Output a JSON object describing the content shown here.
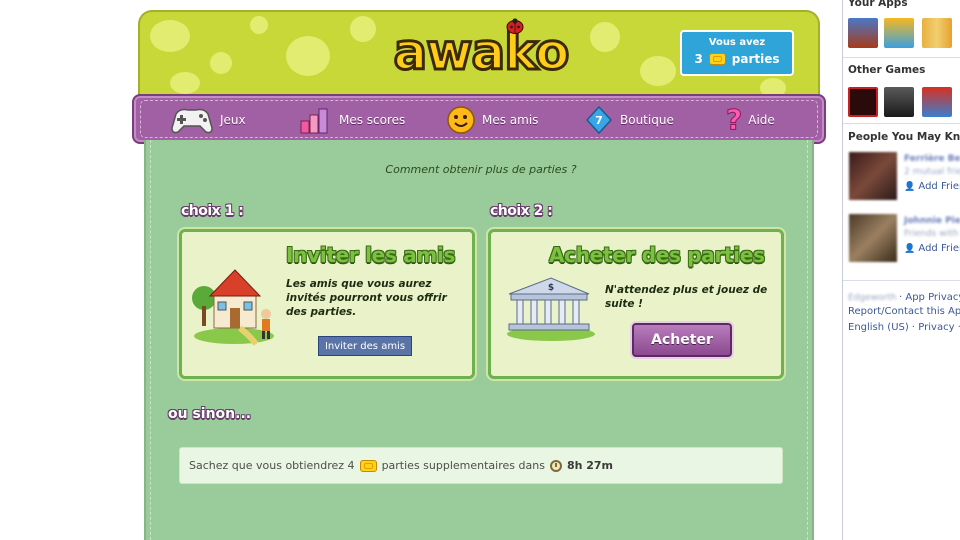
{
  "game": {
    "logo": "awako",
    "counter": {
      "line1": "Vous avez",
      "count": "3",
      "unit": "parties"
    },
    "nav": [
      {
        "label": "Jeux",
        "icon": "gamepad-icon"
      },
      {
        "label": "Mes scores",
        "icon": "bar-chart-icon"
      },
      {
        "label": "Mes amis",
        "icon": "smiley-icon"
      },
      {
        "label": "Boutique",
        "icon": "diamond-icon"
      },
      {
        "label": "Aide",
        "icon": "question-mark-icon"
      }
    ],
    "question": "Comment obtenir plus de parties ?",
    "choix1": {
      "label": "choix 1 :",
      "title": "Inviter les amis",
      "text": "Les amis que vous aurez invités pourront vous offrir des parties.",
      "button": "Inviter des amis"
    },
    "choix2": {
      "label": "choix 2 :",
      "title": "Acheter des parties",
      "text": "N'attendez plus et jouez de suite !",
      "button": "Acheter"
    },
    "sinon": "ou sinon...",
    "info": {
      "prefix": "Sachez que vous obtiendrez 4",
      "middle": "parties supplementaires dans",
      "time": "8h 27m"
    }
  },
  "sidebar": {
    "your_apps": "Your Apps",
    "other_games": "Other Games",
    "people": "People You May Know",
    "person1": {
      "name": "Ferrière Be",
      "sub": "2 mutual frie",
      "add": "Add Frien"
    },
    "person2": {
      "name": "Johnnie Pie",
      "sub": "Friends with",
      "add": "Add Frien"
    },
    "footer1_blur": "Edgeworth",
    "footer1": "· App Privacy",
    "footer2": "Report/Contact this App",
    "footer3": "English (US) · Privacy · Te"
  },
  "colors": {
    "header_green": "#c8d838",
    "nav_purple": "#a15fa4",
    "content_green": "#9acb9a",
    "fb_link": "#3b5998"
  }
}
